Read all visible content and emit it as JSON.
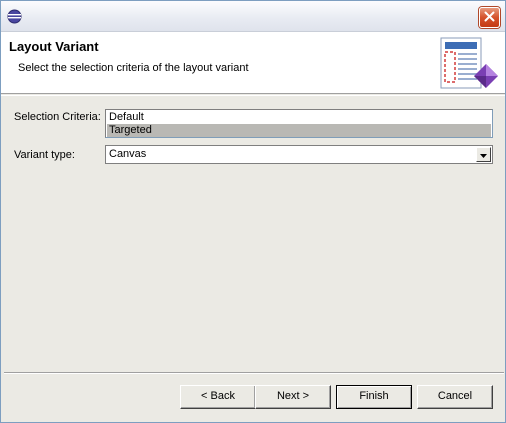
{
  "window": {
    "title_icon": "eclipse-icon",
    "close_icon": "close-icon"
  },
  "banner": {
    "title": "Layout Variant",
    "description": "Select the selection criteria of the layout variant",
    "icon": "layout-wizard-icon"
  },
  "form": {
    "criteria_label": "Selection Criteria:",
    "criteria_options": [
      "Default",
      "Targeted"
    ],
    "criteria_selected": "Targeted",
    "variant_label": "Variant type:",
    "variant_value": "Canvas",
    "variant_arrow_icon": "chevron-down-icon"
  },
  "buttons": {
    "back": "< Back",
    "next": "Next >",
    "finish": "Finish",
    "cancel": "Cancel"
  },
  "colors": {
    "dialog_bg": "#ebeae4",
    "selected_item_bg": "#b9b8b4",
    "close_button": "#d5522b"
  }
}
